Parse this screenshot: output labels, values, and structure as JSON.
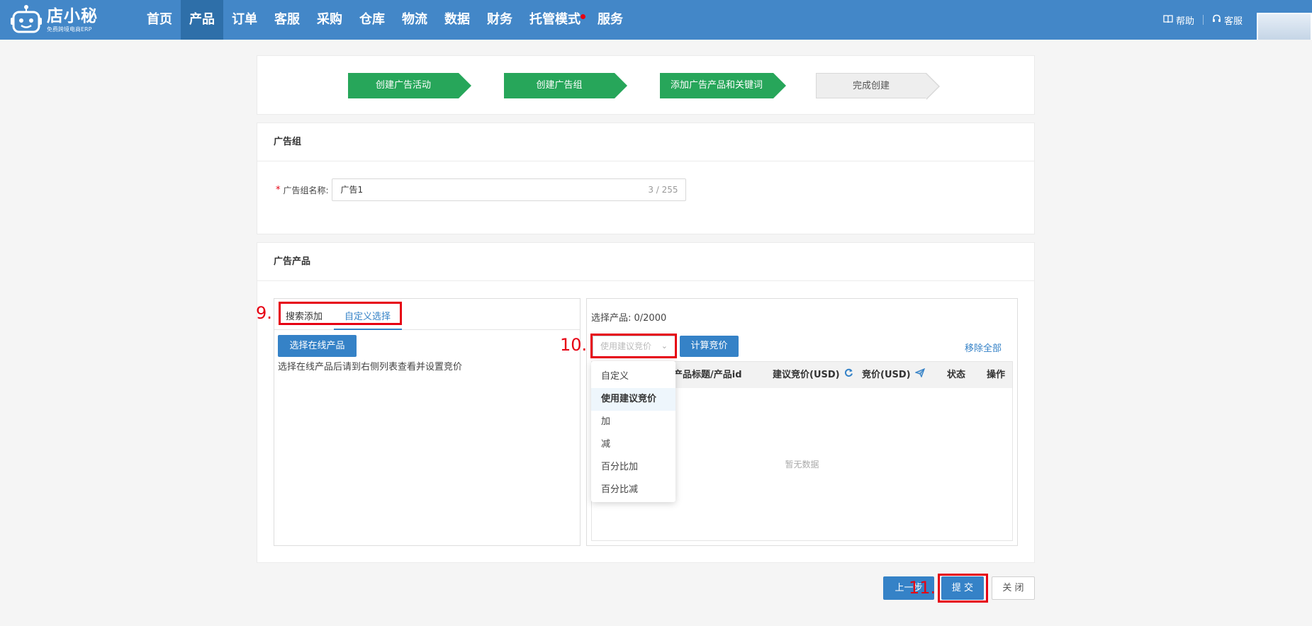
{
  "app": {
    "logo_title": "店小秘",
    "logo_subtitle": "免费跨境电商ERP"
  },
  "nav": {
    "items": [
      {
        "label": "首页"
      },
      {
        "label": "产品",
        "active": true
      },
      {
        "label": "订单"
      },
      {
        "label": "客服"
      },
      {
        "label": "采购"
      },
      {
        "label": "仓库"
      },
      {
        "label": "物流"
      },
      {
        "label": "数据"
      },
      {
        "label": "财务"
      },
      {
        "label": "托管模式",
        "badge_dot": true
      },
      {
        "label": "服务"
      }
    ],
    "help_label": "帮助",
    "service_label": "客服"
  },
  "steps": [
    {
      "label": "创建广告活动",
      "status": "done"
    },
    {
      "label": "创建广告组",
      "status": "done"
    },
    {
      "label": "添加广告产品和关键词",
      "status": "done"
    },
    {
      "label": "完成创建",
      "status": "pending"
    }
  ],
  "ad_group": {
    "section_title": "广告组",
    "name_label": "广告组名称:",
    "name_value": "广告1",
    "name_counter": "3 / 255"
  },
  "ad_products": {
    "section_title": "广告产品",
    "tabs": [
      {
        "label": "搜索添加",
        "active": false
      },
      {
        "label": "自定义选择",
        "active": true
      }
    ],
    "select_online_button": "选择在线产品",
    "hint": "选择在线产品后请到右侧列表查看并设置竞价",
    "selected_count": "选择产品: 0/2000",
    "bid_select_placeholder": "使用建议竞价",
    "calc_bid_button": "计算竞价",
    "remove_all": "移除全部",
    "table_headers": [
      "产品标题/产品id",
      "建议竞价(USD)",
      "竞价(USD)",
      "状态",
      "操作"
    ],
    "empty_text": "暂无数据",
    "bid_options": [
      {
        "label": "自定义",
        "selected": false
      },
      {
        "label": "使用建议竞价",
        "selected": true
      },
      {
        "label": "加",
        "selected": false
      },
      {
        "label": "减",
        "selected": false
      },
      {
        "label": "百分比加",
        "selected": false
      },
      {
        "label": "百分比减",
        "selected": false
      }
    ]
  },
  "annotations": {
    "step9": "9.",
    "step10": "10.",
    "step11": "11."
  },
  "footer": {
    "prev_button": "上一步",
    "submit_button": "提 交",
    "close_button": "关 闭"
  },
  "colors": {
    "topbar": "#4387c8",
    "accent": "#3582c7",
    "step_done": "#27a65a",
    "annotation": "#e60012"
  }
}
